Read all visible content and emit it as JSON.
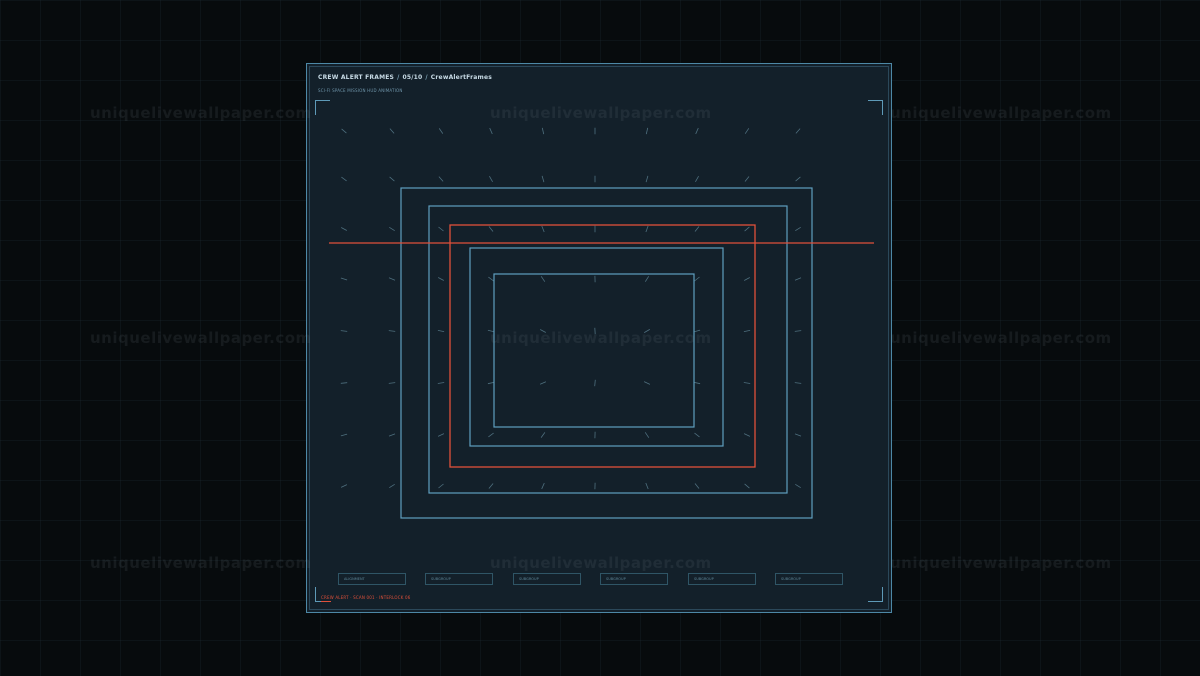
{
  "watermark": {
    "text": "uniquelivewallpaper.com"
  },
  "panel": {
    "title": "CREW ALERT FRAMES",
    "index": "05/10",
    "component": "CrewAlertFrames",
    "subtitle": "SCI-FI SPACE MISSION HUD ANIMATION",
    "status": "CREW ALERT · SCAN 001 · INTERLOCK 06",
    "chips": [
      "ALIGNMENT",
      "SUBGROUP",
      "SUBGROUP",
      "SUBGROUP",
      "SUBGROUP",
      "SUBGROUP"
    ]
  },
  "colors": {
    "frame": "#5f9fbf",
    "alert": "#e0503a",
    "tick": "#5e8394"
  }
}
